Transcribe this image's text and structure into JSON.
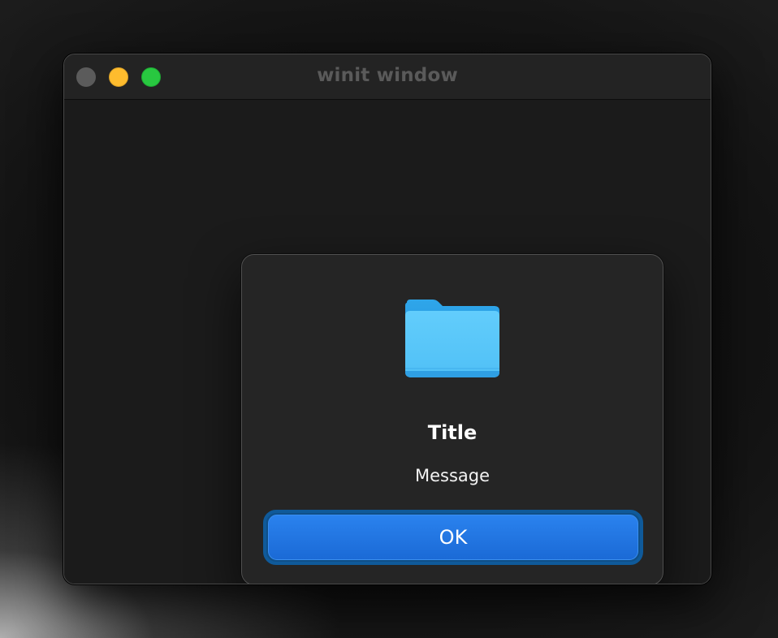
{
  "window": {
    "title": "winit window",
    "controls": {
      "close": "close-button",
      "minimize": "minimize-button",
      "zoom": "zoom-button"
    },
    "colors": {
      "close": "#5b5b5b",
      "minimize": "#febc2e",
      "zoom": "#28c840"
    }
  },
  "alert": {
    "icon": "folder-icon",
    "title": "Title",
    "message": "Message",
    "ok_label": "OK",
    "colors": {
      "button": "#1f74e0",
      "folder": "#5ac8fa"
    }
  }
}
